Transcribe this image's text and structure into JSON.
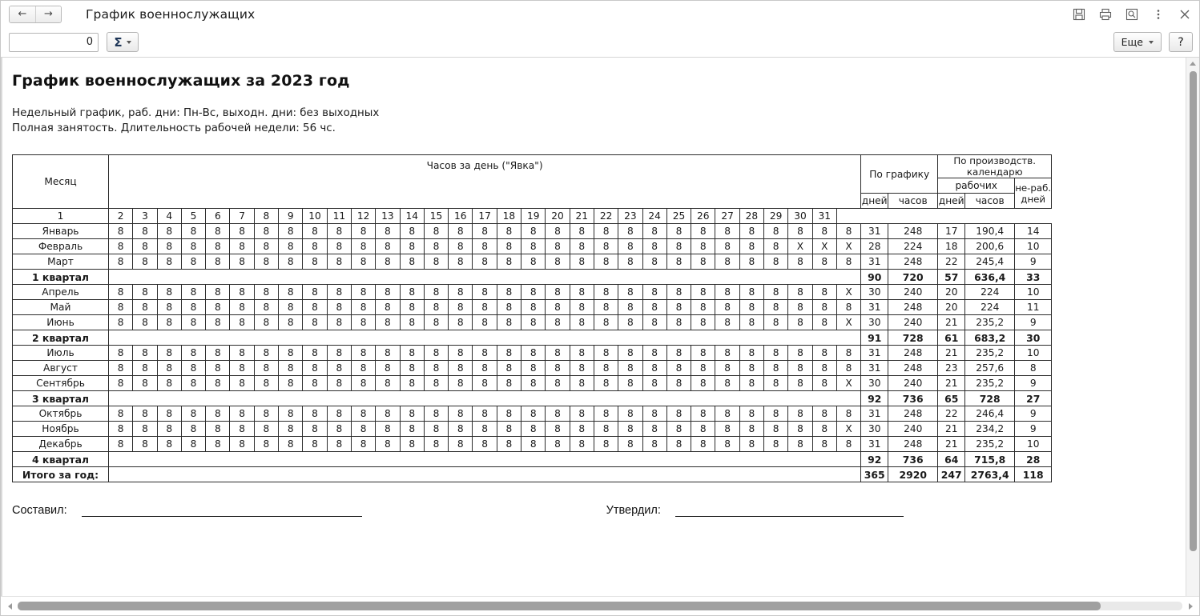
{
  "window": {
    "title": "График военнослужащих",
    "nav": {
      "back": "←",
      "forward": "→"
    },
    "tools": [
      {
        "name": "save-icon",
        "label": "Сохранить"
      },
      {
        "name": "print-icon",
        "label": "Печать"
      },
      {
        "name": "print-preview-icon",
        "label": "Предварительный просмотр"
      },
      {
        "name": "more-menu-icon",
        "label": "Еще"
      },
      {
        "name": "close-icon",
        "label": "Закрыть"
      }
    ]
  },
  "commandbar": {
    "number_value": "0",
    "number_placeholder": "",
    "sigma_label": "Σ",
    "more_label": "Еще",
    "help_label": "?"
  },
  "document": {
    "title": "График военнослужащих за 2023 год",
    "subtitle_line1": "Недельный график, раб. дни: Пн-Вс, выходн. дни: без выходных",
    "subtitle_line2": "Полная занятость. Длительность рабочей недели: 56 чс.",
    "signatures": {
      "composer_label": "Составил:",
      "approver_label": "Утвердил:"
    }
  },
  "table": {
    "headers": {
      "month": "Месяц",
      "days_span": "Часов за день (\"Явка\")",
      "by_schedule": "По графику",
      "by_production_calendar": "По производств. календарю",
      "working": "рабочих",
      "nonworking": "не-раб. дней",
      "sched_days": "дней",
      "sched_hours": "часов",
      "prod_days": "дней",
      "prod_hours": "часов"
    },
    "day_numbers": [
      "1",
      "2",
      "3",
      "4",
      "5",
      "6",
      "7",
      "8",
      "9",
      "10",
      "11",
      "12",
      "13",
      "14",
      "15",
      "16",
      "17",
      "18",
      "19",
      "20",
      "21",
      "22",
      "23",
      "24",
      "25",
      "26",
      "27",
      "28",
      "29",
      "30",
      "31"
    ],
    "rows": [
      {
        "type": "month",
        "label": "Январь",
        "days": [
          "8",
          "8",
          "8",
          "8",
          "8",
          "8",
          "8",
          "8",
          "8",
          "8",
          "8",
          "8",
          "8",
          "8",
          "8",
          "8",
          "8",
          "8",
          "8",
          "8",
          "8",
          "8",
          "8",
          "8",
          "8",
          "8",
          "8",
          "8",
          "8",
          "8",
          "8"
        ],
        "sched_days": "31",
        "sched_hours": "248",
        "prod_days": "17",
        "prod_hours": "190,4",
        "nonwork_days": "14"
      },
      {
        "type": "month",
        "label": "Февраль",
        "days": [
          "8",
          "8",
          "8",
          "8",
          "8",
          "8",
          "8",
          "8",
          "8",
          "8",
          "8",
          "8",
          "8",
          "8",
          "8",
          "8",
          "8",
          "8",
          "8",
          "8",
          "8",
          "8",
          "8",
          "8",
          "8",
          "8",
          "8",
          "8",
          "X",
          "X",
          "X"
        ],
        "sched_days": "28",
        "sched_hours": "224",
        "prod_days": "18",
        "prod_hours": "200,6",
        "nonwork_days": "10"
      },
      {
        "type": "month",
        "label": "Март",
        "days": [
          "8",
          "8",
          "8",
          "8",
          "8",
          "8",
          "8",
          "8",
          "8",
          "8",
          "8",
          "8",
          "8",
          "8",
          "8",
          "8",
          "8",
          "8",
          "8",
          "8",
          "8",
          "8",
          "8",
          "8",
          "8",
          "8",
          "8",
          "8",
          "8",
          "8",
          "8"
        ],
        "sched_days": "31",
        "sched_hours": "248",
        "prod_days": "22",
        "prod_hours": "245,4",
        "nonwork_days": "9"
      },
      {
        "type": "quarter",
        "label": "1 квартал",
        "days": [],
        "sched_days": "90",
        "sched_hours": "720",
        "prod_days": "57",
        "prod_hours": "636,4",
        "nonwork_days": "33"
      },
      {
        "type": "month",
        "label": "Апрель",
        "days": [
          "8",
          "8",
          "8",
          "8",
          "8",
          "8",
          "8",
          "8",
          "8",
          "8",
          "8",
          "8",
          "8",
          "8",
          "8",
          "8",
          "8",
          "8",
          "8",
          "8",
          "8",
          "8",
          "8",
          "8",
          "8",
          "8",
          "8",
          "8",
          "8",
          "8",
          "X"
        ],
        "sched_days": "30",
        "sched_hours": "240",
        "prod_days": "20",
        "prod_hours": "224",
        "nonwork_days": "10"
      },
      {
        "type": "month",
        "label": "Май",
        "days": [
          "8",
          "8",
          "8",
          "8",
          "8",
          "8",
          "8",
          "8",
          "8",
          "8",
          "8",
          "8",
          "8",
          "8",
          "8",
          "8",
          "8",
          "8",
          "8",
          "8",
          "8",
          "8",
          "8",
          "8",
          "8",
          "8",
          "8",
          "8",
          "8",
          "8",
          "8"
        ],
        "sched_days": "31",
        "sched_hours": "248",
        "prod_days": "20",
        "prod_hours": "224",
        "nonwork_days": "11"
      },
      {
        "type": "month",
        "label": "Июнь",
        "days": [
          "8",
          "8",
          "8",
          "8",
          "8",
          "8",
          "8",
          "8",
          "8",
          "8",
          "8",
          "8",
          "8",
          "8",
          "8",
          "8",
          "8",
          "8",
          "8",
          "8",
          "8",
          "8",
          "8",
          "8",
          "8",
          "8",
          "8",
          "8",
          "8",
          "8",
          "X"
        ],
        "sched_days": "30",
        "sched_hours": "240",
        "prod_days": "21",
        "prod_hours": "235,2",
        "nonwork_days": "9"
      },
      {
        "type": "quarter",
        "label": "2 квартал",
        "days": [],
        "sched_days": "91",
        "sched_hours": "728",
        "prod_days": "61",
        "prod_hours": "683,2",
        "nonwork_days": "30"
      },
      {
        "type": "month",
        "label": "Июль",
        "days": [
          "8",
          "8",
          "8",
          "8",
          "8",
          "8",
          "8",
          "8",
          "8",
          "8",
          "8",
          "8",
          "8",
          "8",
          "8",
          "8",
          "8",
          "8",
          "8",
          "8",
          "8",
          "8",
          "8",
          "8",
          "8",
          "8",
          "8",
          "8",
          "8",
          "8",
          "8"
        ],
        "sched_days": "31",
        "sched_hours": "248",
        "prod_days": "21",
        "prod_hours": "235,2",
        "nonwork_days": "10"
      },
      {
        "type": "month",
        "label": "Август",
        "days": [
          "8",
          "8",
          "8",
          "8",
          "8",
          "8",
          "8",
          "8",
          "8",
          "8",
          "8",
          "8",
          "8",
          "8",
          "8",
          "8",
          "8",
          "8",
          "8",
          "8",
          "8",
          "8",
          "8",
          "8",
          "8",
          "8",
          "8",
          "8",
          "8",
          "8",
          "8"
        ],
        "sched_days": "31",
        "sched_hours": "248",
        "prod_days": "23",
        "prod_hours": "257,6",
        "nonwork_days": "8"
      },
      {
        "type": "month",
        "label": "Сентябрь",
        "days": [
          "8",
          "8",
          "8",
          "8",
          "8",
          "8",
          "8",
          "8",
          "8",
          "8",
          "8",
          "8",
          "8",
          "8",
          "8",
          "8",
          "8",
          "8",
          "8",
          "8",
          "8",
          "8",
          "8",
          "8",
          "8",
          "8",
          "8",
          "8",
          "8",
          "8",
          "X"
        ],
        "sched_days": "30",
        "sched_hours": "240",
        "prod_days": "21",
        "prod_hours": "235,2",
        "nonwork_days": "9"
      },
      {
        "type": "quarter",
        "label": "3 квартал",
        "days": [],
        "sched_days": "92",
        "sched_hours": "736",
        "prod_days": "65",
        "prod_hours": "728",
        "nonwork_days": "27"
      },
      {
        "type": "month",
        "label": "Октябрь",
        "days": [
          "8",
          "8",
          "8",
          "8",
          "8",
          "8",
          "8",
          "8",
          "8",
          "8",
          "8",
          "8",
          "8",
          "8",
          "8",
          "8",
          "8",
          "8",
          "8",
          "8",
          "8",
          "8",
          "8",
          "8",
          "8",
          "8",
          "8",
          "8",
          "8",
          "8",
          "8"
        ],
        "sched_days": "31",
        "sched_hours": "248",
        "prod_days": "22",
        "prod_hours": "246,4",
        "nonwork_days": "9"
      },
      {
        "type": "month",
        "label": "Ноябрь",
        "days": [
          "8",
          "8",
          "8",
          "8",
          "8",
          "8",
          "8",
          "8",
          "8",
          "8",
          "8",
          "8",
          "8",
          "8",
          "8",
          "8",
          "8",
          "8",
          "8",
          "8",
          "8",
          "8",
          "8",
          "8",
          "8",
          "8",
          "8",
          "8",
          "8",
          "8",
          "X"
        ],
        "sched_days": "30",
        "sched_hours": "240",
        "prod_days": "21",
        "prod_hours": "234,2",
        "nonwork_days": "9"
      },
      {
        "type": "month",
        "label": "Декабрь",
        "days": [
          "8",
          "8",
          "8",
          "8",
          "8",
          "8",
          "8",
          "8",
          "8",
          "8",
          "8",
          "8",
          "8",
          "8",
          "8",
          "8",
          "8",
          "8",
          "8",
          "8",
          "8",
          "8",
          "8",
          "8",
          "8",
          "8",
          "8",
          "8",
          "8",
          "8",
          "8"
        ],
        "sched_days": "31",
        "sched_hours": "248",
        "prod_days": "21",
        "prod_hours": "235,2",
        "nonwork_days": "10"
      },
      {
        "type": "quarter",
        "label": "4 квартал",
        "days": [],
        "sched_days": "92",
        "sched_hours": "736",
        "prod_days": "64",
        "prod_hours": "715,8",
        "nonwork_days": "28"
      },
      {
        "type": "total",
        "label": "Итого за год:",
        "days": [],
        "sched_days": "365",
        "sched_hours": "2920",
        "prod_days": "247",
        "prod_hours": "2763,4",
        "nonwork_days": "118"
      }
    ]
  }
}
